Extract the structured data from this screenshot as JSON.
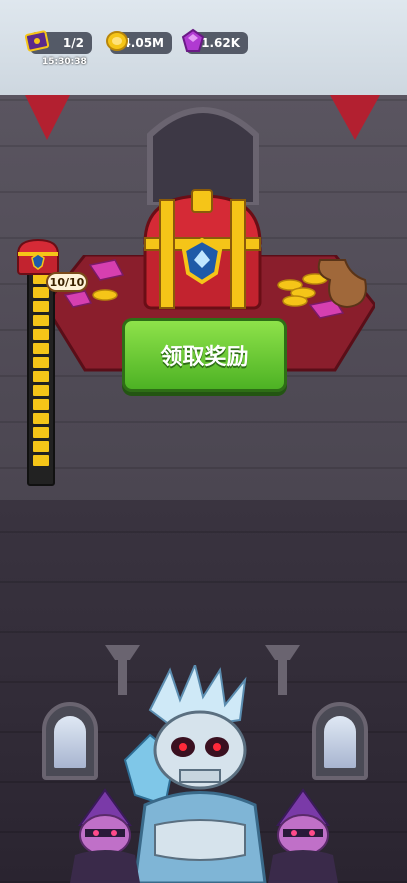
{
  "top_bar": {
    "book": {
      "value": "1/2",
      "timer": "15:30:38",
      "icon": "spellbook-icon"
    },
    "gold": {
      "value": "4.05M",
      "icon": "gold-coin-icon"
    },
    "gems": {
      "value": "1.62K",
      "icon": "purple-gem-icon"
    }
  },
  "reward": {
    "claim_label": "领取奖励",
    "chest_icon": "treasure-chest-icon"
  },
  "progress": {
    "label": "10/10",
    "fill_fraction": 1.0
  },
  "colors": {
    "button_green": "#5cc12a",
    "gold": "#f5c518",
    "gem_purple": "#b03ad1"
  }
}
